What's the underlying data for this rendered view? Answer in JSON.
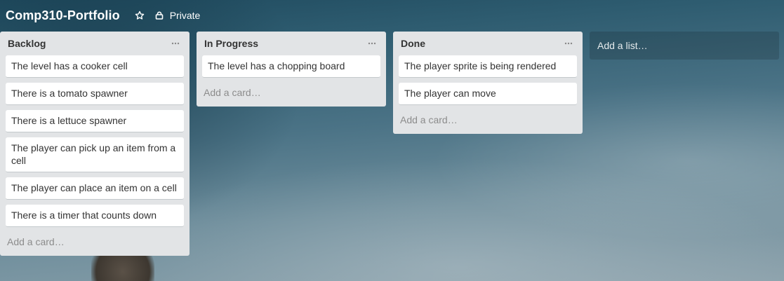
{
  "board": {
    "title": "Comp310-Portfolio",
    "privacy_label": "Private"
  },
  "icons": {
    "star": "star-icon",
    "lock": "lock-icon",
    "menu": "ellipsis-icon"
  },
  "lists": [
    {
      "title": "Backlog",
      "cards": [
        "The level has a cooker cell",
        "There is a tomato spawner",
        "There is a lettuce spawner",
        "The player can pick up an item from a cell",
        "The player can place an item on a cell",
        "There is a timer that counts down"
      ],
      "add_card_label": "Add a card…"
    },
    {
      "title": "In Progress",
      "cards": [
        "The level has a chopping board"
      ],
      "add_card_label": "Add a card…"
    },
    {
      "title": "Done",
      "cards": [
        "The player sprite is being rendered",
        "The player can move"
      ],
      "add_card_label": "Add a card…"
    }
  ],
  "add_list_label": "Add a list…",
  "colors": {
    "list_bg": "#e2e4e6",
    "card_bg": "#ffffff",
    "text": "#333333",
    "muted": "#8c8c8c"
  }
}
